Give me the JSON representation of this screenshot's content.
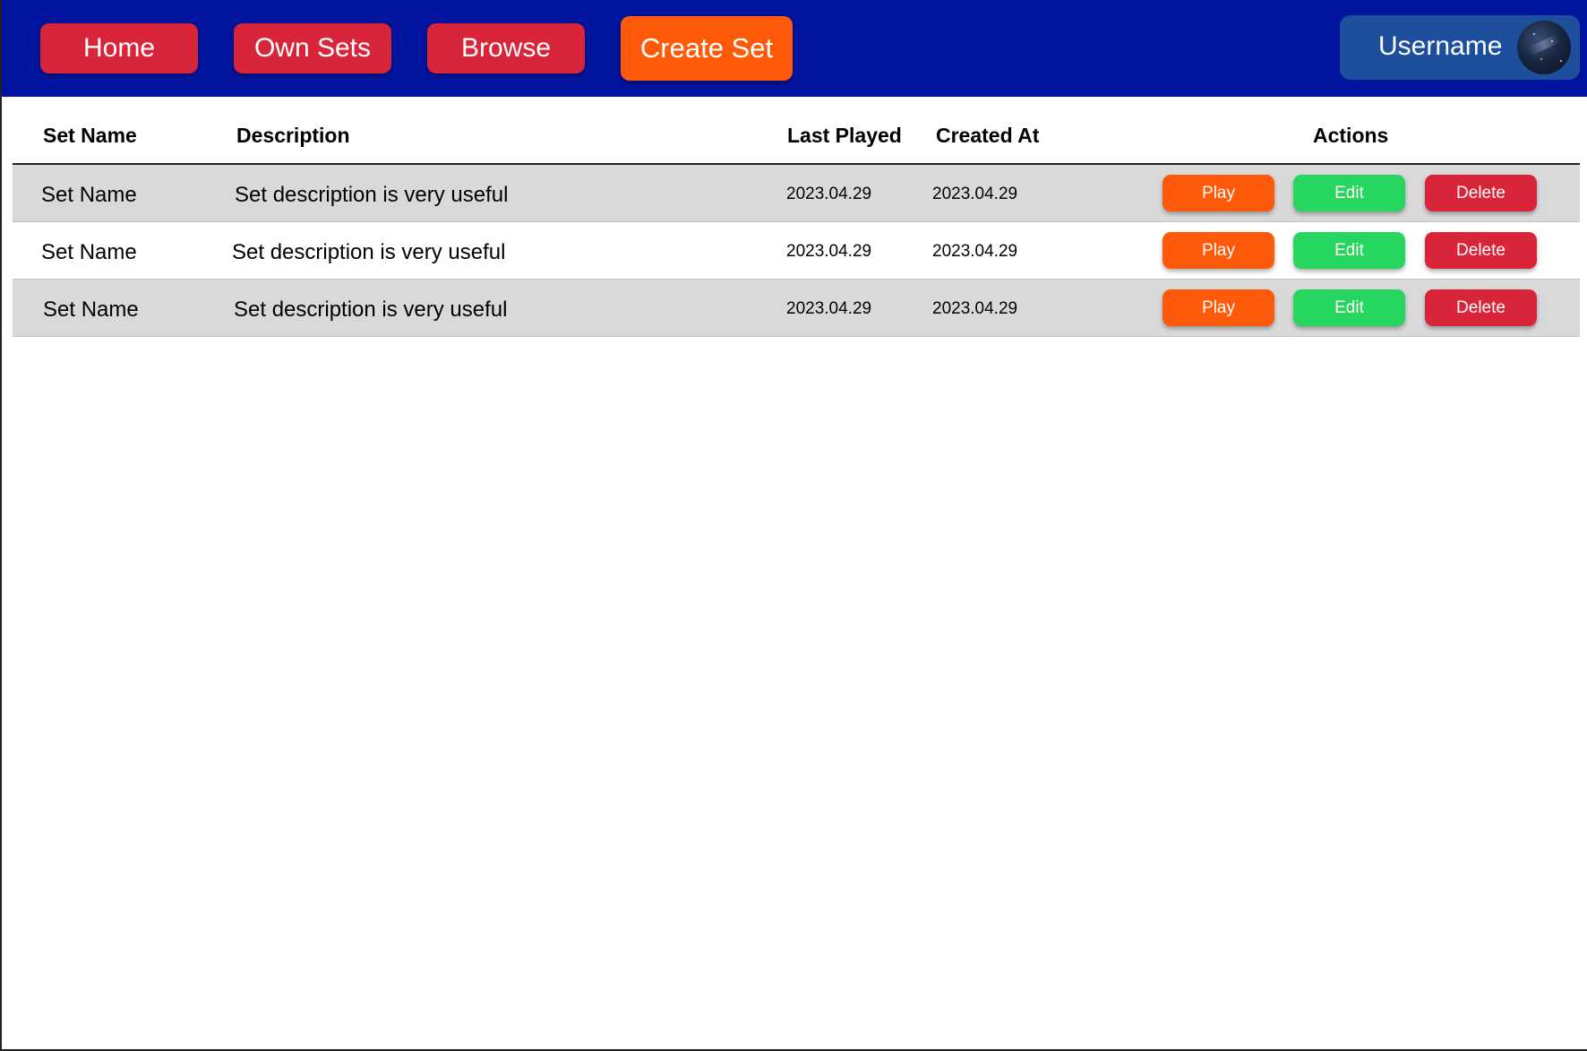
{
  "nav": {
    "home": "Home",
    "own_sets": "Own Sets",
    "browse": "Browse",
    "create_set": "Create Set"
  },
  "user": {
    "name": "Username",
    "avatar_icon": "avatar-image"
  },
  "table": {
    "headers": {
      "set_name": "Set Name",
      "description": "Description",
      "last_played": "Last Played",
      "created_at": "Created At",
      "actions": "Actions"
    },
    "rows": [
      {
        "name": "Set Name",
        "description": "Set description is very useful",
        "last_played": "2023.04.29",
        "created_at": "2023.04.29",
        "play": "Play",
        "edit": "Edit",
        "delete": "Delete"
      },
      {
        "name": "Set Name",
        "description": "Set description is very useful",
        "last_played": "2023.04.29",
        "created_at": "2023.04.29",
        "play": "Play",
        "edit": "Edit",
        "delete": "Delete"
      },
      {
        "name": "Set Name",
        "description": "Set description is very useful",
        "last_played": "2023.04.29",
        "created_at": "2023.04.29",
        "play": "Play",
        "edit": "Edit",
        "delete": "Delete"
      }
    ]
  },
  "colors": {
    "navbar": "#0014a0",
    "nav_button": "#d9253a",
    "create_button": "#ff5a0a",
    "user_box": "#1d4f9c",
    "play": "#ff5a0a",
    "edit": "#26d65e",
    "delete": "#d9253a",
    "row_shade": "#d9d9d9"
  }
}
